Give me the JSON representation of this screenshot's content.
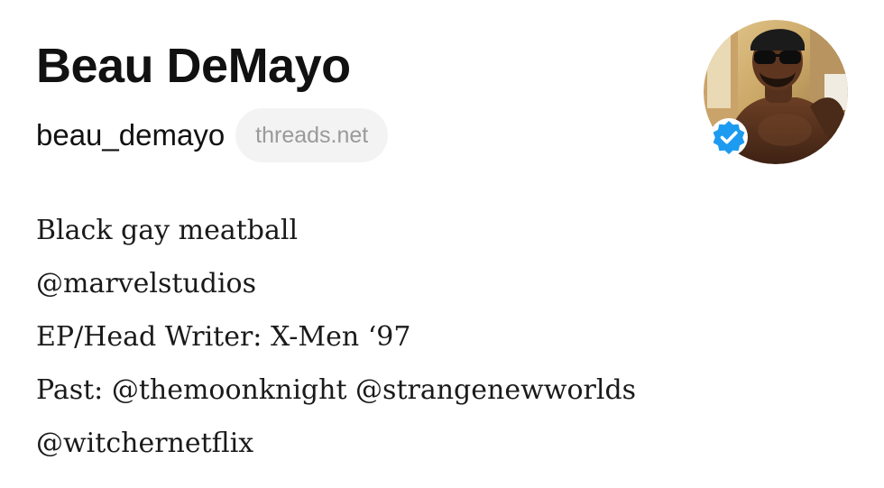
{
  "profile": {
    "display_name": "Beau DeMayo",
    "username": "beau_demayo",
    "domain": "threads.net",
    "verified": true,
    "verified_icon": "verified-check-icon",
    "verified_color": "#1d9bf0"
  },
  "bio": {
    "lines": [
      "Black gay meatball",
      "@marvelstudios",
      "EP/Head Writer: X-Men ‘97",
      "Past: @themoonknight @strangenewworlds",
      "@witchernetflix"
    ]
  }
}
